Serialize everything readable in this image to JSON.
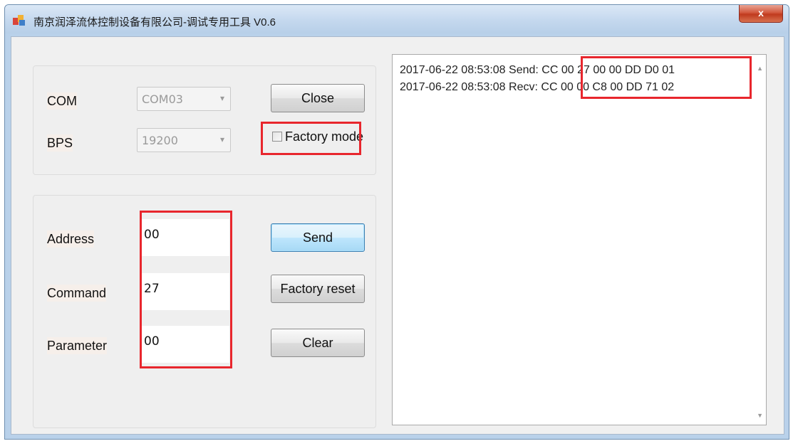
{
  "window": {
    "title": "南京润泽流体控制设备有限公司-调试专用工具 V0.6",
    "close_glyph": "x"
  },
  "serial": {
    "com_label": "COM",
    "com_value": "COM03",
    "bps_label": "BPS",
    "bps_value": "19200",
    "close_label": "Close",
    "factory_mode_label": "Factory mode",
    "factory_mode_checked": false
  },
  "command": {
    "address_label": "Address",
    "address_value": "00",
    "command_label": "Command",
    "command_value": "27",
    "parameter_label": "Parameter",
    "parameter_value": "00",
    "send_label": "Send",
    "factory_reset_label": "Factory reset",
    "clear_label": "Clear"
  },
  "log": {
    "lines": [
      {
        "timestamp": "2017-06-22 08:53:08",
        "direction": "Send:",
        "bytes": "CC 00 27 00 00 DD D0 01"
      },
      {
        "timestamp": "2017-06-22 08:53:08",
        "direction": "Recv:",
        "bytes": "CC 00 00 C8 00 DD 71 02"
      }
    ]
  },
  "colors": {
    "highlight": "#e8262d",
    "focus_button": "#3c7fb1",
    "titlebar": "#c4d8ee"
  },
  "icons": {
    "app": "app-icon",
    "dropdown": "chevron-down-icon",
    "scroll_up": "scroll-up-icon",
    "scroll_down": "scroll-down-icon"
  }
}
